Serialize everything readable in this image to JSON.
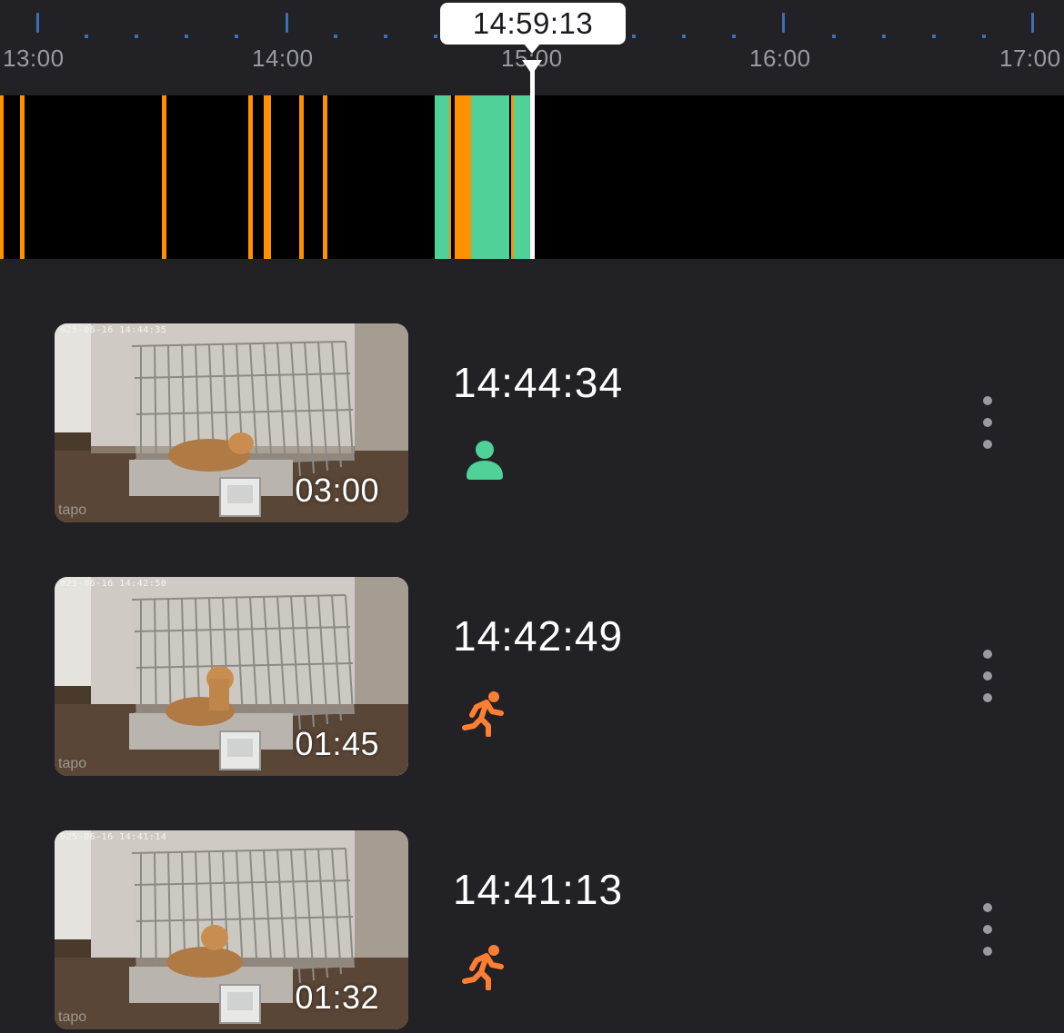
{
  "timeline": {
    "current_time": "14:59:13",
    "hour_labels": [
      "13:00",
      "14:00",
      "15:00",
      "16:00",
      "17:00"
    ],
    "colors": {
      "tick": "#3d6fb3",
      "motion": "#ff9100",
      "person": "#4fd198",
      "background": "#000000"
    }
  },
  "events": [
    {
      "time": "14:44:34",
      "duration": "03:00",
      "type": "person",
      "icon": "person-icon",
      "thumb_stamp": "025-06-16 14:44:35",
      "watermark": "tapo"
    },
    {
      "time": "14:42:49",
      "duration": "01:45",
      "type": "motion",
      "icon": "running-person-icon",
      "thumb_stamp": "025-06-16 14:42:50",
      "watermark": "tapo"
    },
    {
      "time": "14:41:13",
      "duration": "01:32",
      "type": "motion",
      "icon": "running-person-icon",
      "thumb_stamp": "025-06-16 14:41:14",
      "watermark": "tapo"
    }
  ]
}
